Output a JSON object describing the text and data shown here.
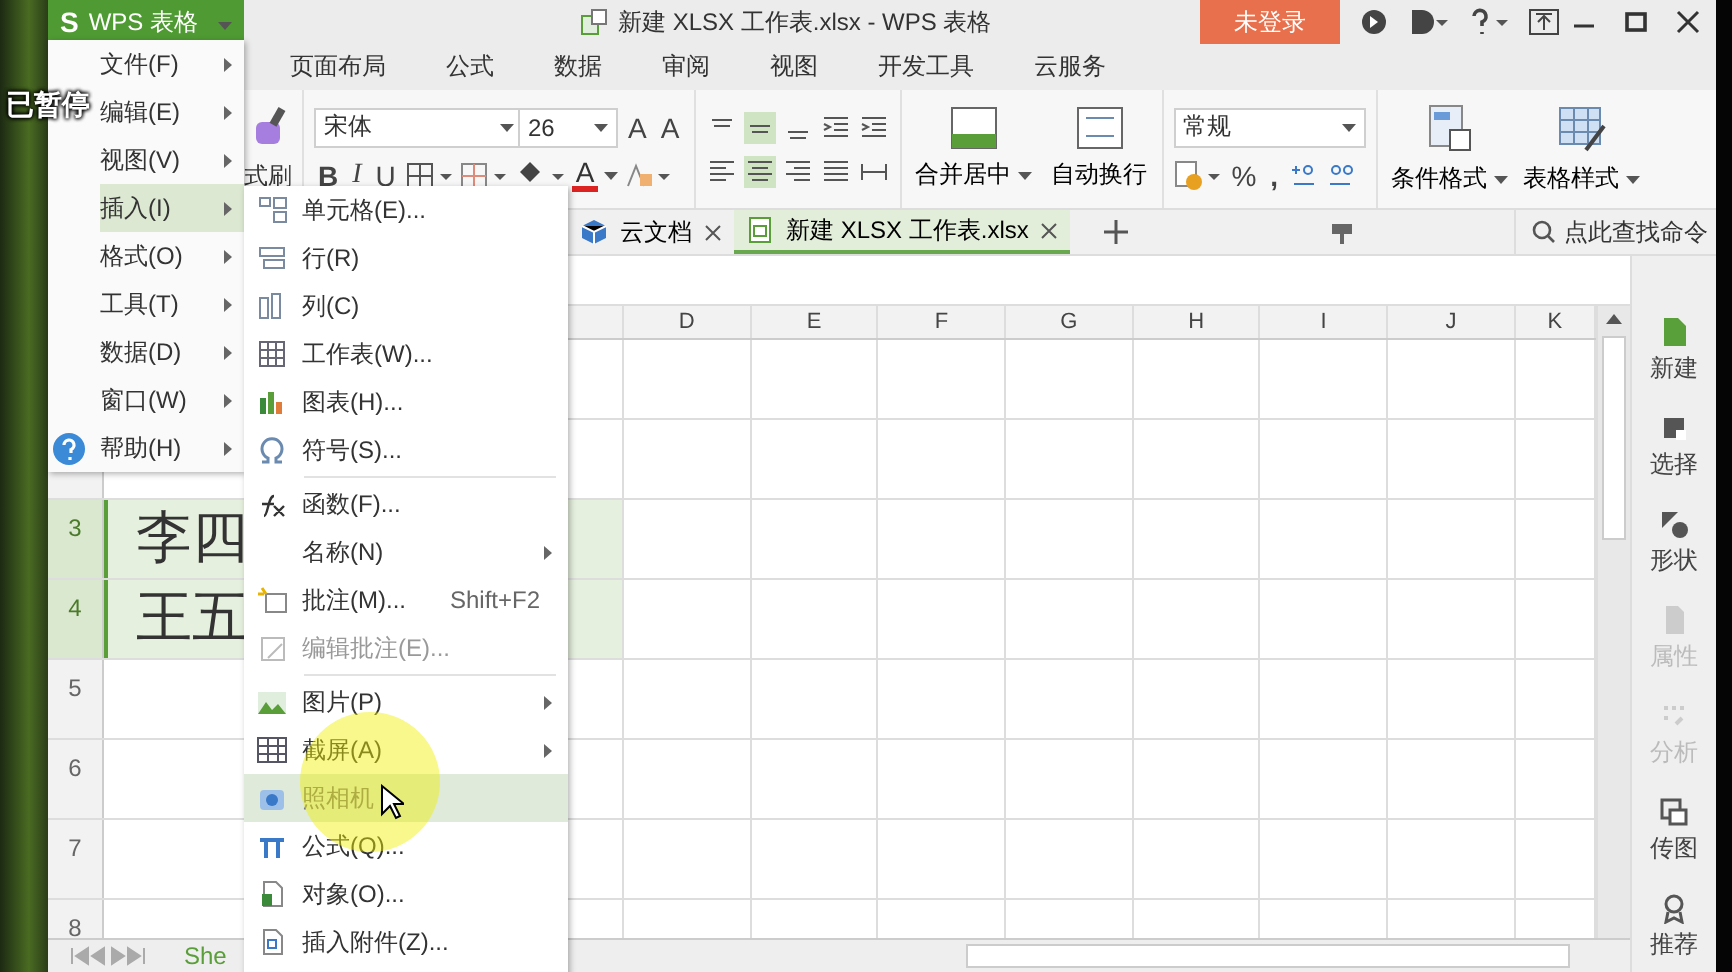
{
  "video_overlay": {
    "text": "已暂停"
  },
  "app_button": {
    "logo": "S",
    "label": "WPS 表格"
  },
  "title_bar": {
    "title": "新建 XLSX 工作表.xlsx - WPS 表格",
    "login_button": "未登录"
  },
  "ribbon_tabs": [
    {
      "label": "页面布局"
    },
    {
      "label": "公式"
    },
    {
      "label": "数据"
    },
    {
      "label": "审阅"
    },
    {
      "label": "视图"
    },
    {
      "label": "开发工具"
    },
    {
      "label": "云服务"
    }
  ],
  "ribbon": {
    "format_painter_label": "式刷",
    "font_name": "宋体",
    "font_size": "26",
    "grow_font": "A",
    "shrink_font": "A",
    "bold": "B",
    "italic": "I",
    "underline": "U",
    "font_color": "A",
    "merge_label": "合并居中",
    "wrap_label": "自动换行",
    "number_format": "常规",
    "percent": "%",
    "comma": ",",
    "conditional_format_label": "条件格式",
    "table_style_label": "表格样式"
  },
  "doc_tabs": [
    {
      "kind": "cloud",
      "label": "云文档",
      "selected": false
    },
    {
      "kind": "file",
      "label": "新建 XLSX 工作表.xlsx",
      "selected": true
    }
  ],
  "command_search": {
    "placeholder": "点此查找命令"
  },
  "main_menu": [
    {
      "kind": "plain",
      "label": "文件(F)",
      "selected": false
    },
    {
      "kind": "plain",
      "label": "编辑(E)",
      "selected": false
    },
    {
      "kind": "plain",
      "label": "视图(V)",
      "selected": false
    },
    {
      "kind": "plain",
      "label": "插入(I)",
      "selected": true
    },
    {
      "kind": "plain",
      "label": "格式(O)",
      "selected": false
    },
    {
      "kind": "plain",
      "label": "工具(T)",
      "selected": false
    },
    {
      "kind": "plain",
      "label": "数据(D)",
      "selected": false
    },
    {
      "kind": "plain",
      "label": "窗口(W)",
      "selected": false
    },
    {
      "kind": "help",
      "label": "帮助(H)",
      "selected": false
    }
  ],
  "insert_submenu": [
    {
      "kind": "item",
      "label": "单元格(E)...",
      "disabled": false,
      "selected": false,
      "has_submenu": false
    },
    {
      "kind": "item",
      "label": "行(R)",
      "disabled": false,
      "selected": false,
      "has_submenu": false
    },
    {
      "kind": "item",
      "label": "列(C)",
      "disabled": false,
      "selected": false,
      "has_submenu": false
    },
    {
      "kind": "item",
      "label": "工作表(W)...",
      "disabled": false,
      "selected": false,
      "has_submenu": false
    },
    {
      "kind": "item",
      "label": "图表(H)...",
      "disabled": false,
      "selected": false,
      "has_submenu": false
    },
    {
      "kind": "item",
      "label": "符号(S)...",
      "disabled": false,
      "selected": false,
      "has_submenu": false
    },
    {
      "kind": "separator"
    },
    {
      "kind": "item",
      "label": "函数(F)...",
      "disabled": false,
      "selected": false,
      "has_submenu": false
    },
    {
      "kind": "item",
      "label": "名称(N)",
      "disabled": false,
      "selected": false,
      "has_submenu": true
    },
    {
      "kind": "item",
      "label": "批注(M)...",
      "shortcut": "Shift+F2",
      "disabled": false,
      "selected": false,
      "has_submenu": false
    },
    {
      "kind": "item",
      "label": "编辑批注(E)...",
      "disabled": true,
      "selected": false,
      "has_submenu": false
    },
    {
      "kind": "separator"
    },
    {
      "kind": "item",
      "label": "图片(P)",
      "disabled": false,
      "selected": false,
      "has_submenu": true
    },
    {
      "kind": "item",
      "label": "截屏(A)",
      "disabled": false,
      "selected": false,
      "has_submenu": true
    },
    {
      "kind": "item",
      "label": "照相机",
      "disabled": true,
      "selected": true,
      "has_submenu": false
    },
    {
      "kind": "item",
      "label": "公式(Q)...",
      "disabled": false,
      "selected": false,
      "has_submenu": false
    },
    {
      "kind": "item",
      "label": "对象(O)...",
      "disabled": false,
      "selected": false,
      "has_submenu": false
    },
    {
      "kind": "item",
      "label": "插入附件(Z)...",
      "disabled": false,
      "selected": false,
      "has_submenu": false
    }
  ],
  "grid": {
    "columns": [
      "D",
      "E",
      "F",
      "G",
      "H",
      "I",
      "J",
      "K"
    ],
    "rows": [
      {
        "label": "3",
        "selected": true,
        "cell": "李四"
      },
      {
        "label": "4",
        "selected": true,
        "cell": "王五"
      },
      {
        "label": "5",
        "selected": false
      },
      {
        "label": "6",
        "selected": false
      },
      {
        "label": "7",
        "selected": false
      },
      {
        "label": "8",
        "selected": false
      }
    ]
  },
  "sheet_tabs": [
    {
      "label": "She"
    }
  ],
  "sidebar": [
    {
      "label": "新建",
      "disabled": false
    },
    {
      "label": "选择",
      "disabled": false
    },
    {
      "label": "形状",
      "disabled": false
    },
    {
      "label": "属性",
      "disabled": true
    },
    {
      "label": "分析",
      "disabled": true
    },
    {
      "label": "传图",
      "disabled": false
    },
    {
      "label": "推荐",
      "disabled": false
    }
  ]
}
